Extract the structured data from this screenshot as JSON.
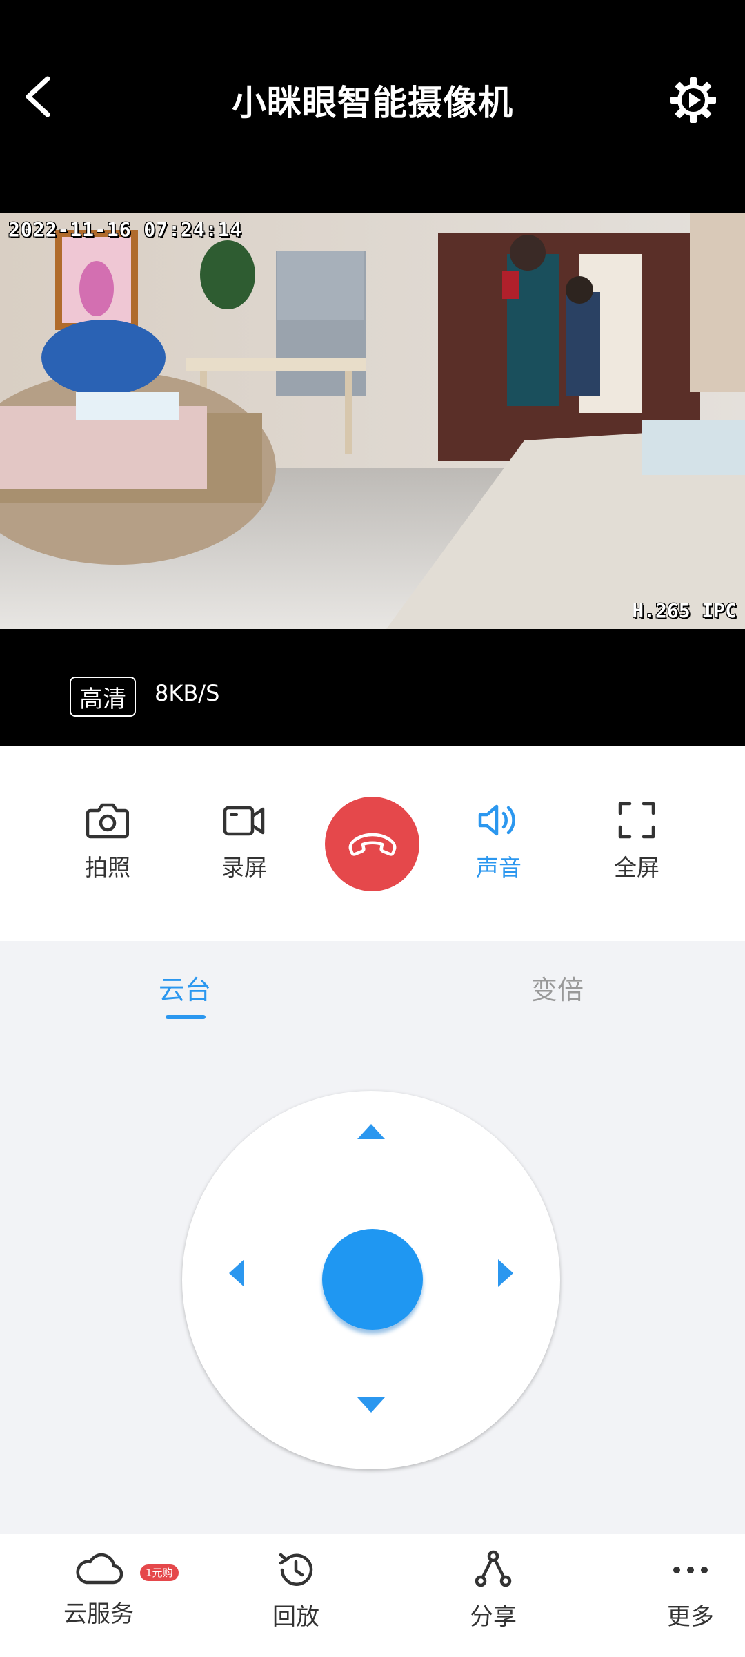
{
  "header": {
    "title": "小眯眼智能摄像机"
  },
  "video": {
    "osd_timestamp": "2022-11-16 07:24:14",
    "osd_codec": "H.265 IPC"
  },
  "stream": {
    "quality": "高清",
    "speed": "8KB/S"
  },
  "controls": {
    "snapshot": "拍照",
    "record": "录屏",
    "sound": "声音",
    "fullscreen": "全屏"
  },
  "tabs": {
    "ptz": "云台",
    "zoom": "变倍"
  },
  "nav": {
    "cloud": "云服务",
    "cloud_badge": "1元购",
    "playback": "回放",
    "share": "分享",
    "more": "更多"
  },
  "colors": {
    "accent": "#2b97ef",
    "hangup": "#e5484b",
    "pad_center": "#1f97f2"
  },
  "icons": [
    "back-icon",
    "gear-icon",
    "camera-icon",
    "video-camera-icon",
    "phone-hangup-icon",
    "speaker-icon",
    "fullscreen-icon",
    "cloud-icon",
    "history-icon",
    "share-icon",
    "more-dots-icon"
  ]
}
